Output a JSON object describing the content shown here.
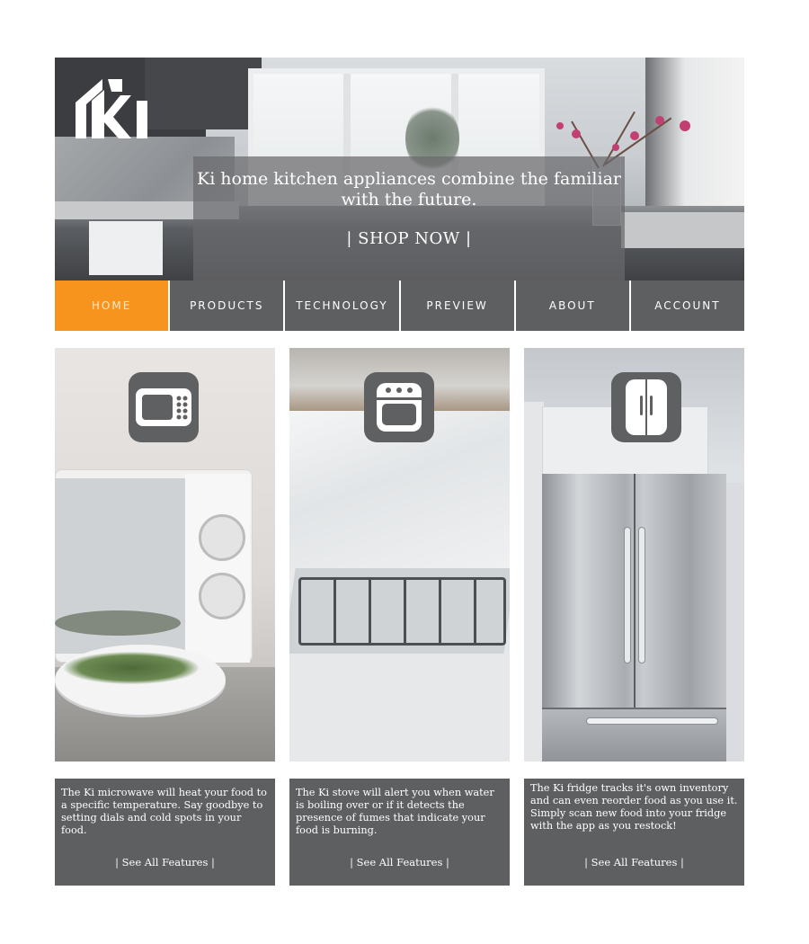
{
  "brand": {
    "logo_text": "Ki"
  },
  "hero": {
    "tagline": "Ki home kitchen appliances combine the familiar with the future.",
    "cta": "| SHOP NOW |"
  },
  "nav": {
    "items": [
      "HOME",
      "PRODUCTS",
      "TECHNOLOGY",
      "PREVIEW",
      "ABOUT",
      "ACCOUNT"
    ],
    "active": "HOME"
  },
  "cards": [
    {
      "icon": "microwave-icon",
      "description": "The Ki microwave will heat your food to a specific temperature. Say goodbye to setting dials and cold spots in your food.",
      "link": "| See All Features |"
    },
    {
      "icon": "stove-icon",
      "description": "The Ki stove will alert you when water is boiling over or if it detects the presence of fumes that indicate your food is burning.",
      "link": "| See All Features |"
    },
    {
      "icon": "fridge-icon",
      "description": "The Ki fridge tracks it's own inventory and can even reorder food as you use it. Simply scan new food into your fridge with the app as you restock!",
      "link": "| See All Features |"
    }
  ],
  "colors": {
    "nav_bg": "#5e5f61",
    "nav_active": "#f7941e",
    "card_text_bg": "#5e5f61",
    "icon_tile": "#5f6062"
  }
}
